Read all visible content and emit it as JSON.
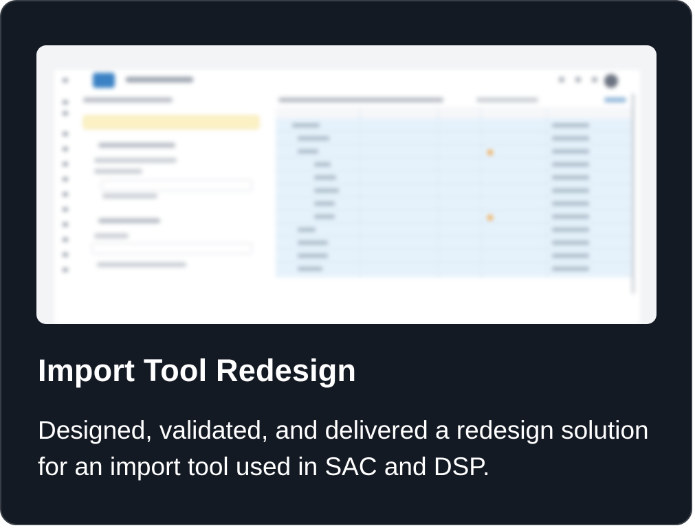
{
  "card": {
    "title": "Import Tool Redesign",
    "description": "Designed, validated, and delivered a redesign solution for an import tool used in SAC and DSP.",
    "colors": {
      "background": "#141a24",
      "border": "#3a3f47",
      "text": "#ffffff"
    }
  },
  "preview": {
    "image_description_icon": "blurred-app-screenshot",
    "highlight_colors": {
      "table_selection": "#e6f2fb",
      "warning": "#f0a64a",
      "notice": "#fbf1c5"
    }
  }
}
